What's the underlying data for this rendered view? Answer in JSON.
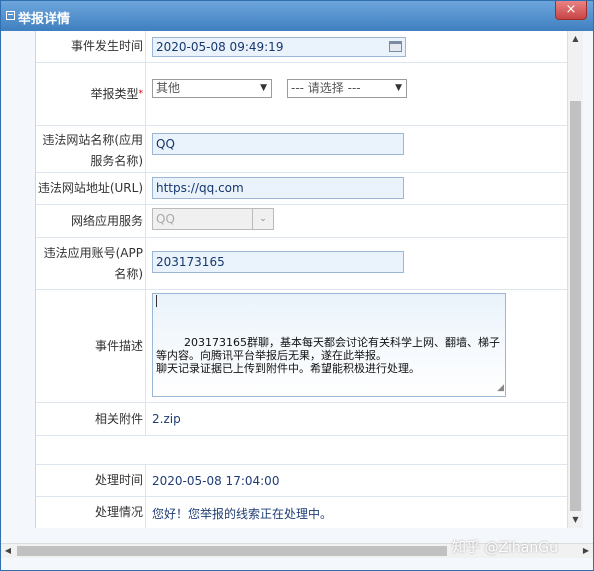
{
  "window": {
    "title": "举报详情",
    "close_label": "×"
  },
  "fields": {
    "event_time": {
      "label": "事件发生时间",
      "value": "2020-05-08 09:49:19"
    },
    "report_type": {
      "label": "举报类型",
      "required_mark": "*",
      "selected": "其他",
      "secondary_selected": "--- 请选择 ---"
    },
    "site_name": {
      "label_line1": "违法网站名称(应用",
      "label_line2": "服务名称)",
      "value": "QQ"
    },
    "site_url": {
      "label": "违法网站地址(URL)",
      "value": "https://qq.com"
    },
    "network_service": {
      "label": "网络应用服务",
      "selected": "QQ"
    },
    "app_account": {
      "label_line1": "违法应用账号(APP",
      "label_line2": "名称)",
      "value": "203173165"
    },
    "description": {
      "label": "事件描述",
      "value": "203173165群聊，基本每天都会讨论有关科学上网、翻墙、梯子等内容。向腾讯平台举报后无果，遂在此举报。\n聊天记录证据已上传到附件中。希望能积极进行处理。"
    },
    "attachment": {
      "label": "相关附件",
      "value": "2.zip"
    },
    "process_time": {
      "label": "处理时间",
      "value": "2020-05-08 17:04:00"
    },
    "process_status": {
      "label": "处理情况",
      "value": "您好！您举报的线索正在处理中。"
    }
  },
  "watermark": "知乎 @ZihanGu",
  "icons": {
    "calendar": "calendar-icon",
    "dropdown": "chevron-down-icon",
    "resize": "resize-grip-icon"
  }
}
